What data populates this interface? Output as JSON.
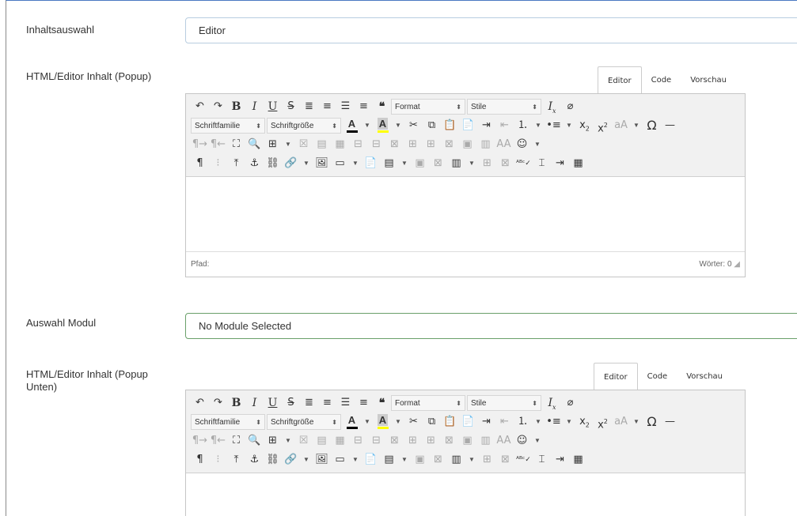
{
  "fields": {
    "inhaltsauswahl": {
      "label": "Inhaltsauswahl",
      "value": "Editor"
    },
    "editor1": {
      "label": "HTML/Editor Inhalt (Popup)"
    },
    "auswahl_modul": {
      "label": "Auswahl Modul",
      "value": "No Module Selected"
    },
    "editor2": {
      "label_line1": "HTML/Editor Inhalt (Popup",
      "label_line2": "Unten)"
    }
  },
  "tabs": {
    "editor": "Editor",
    "code": "Code",
    "vorschau": "Vorschau"
  },
  "toolbar": {
    "format_label": "Format",
    "stile_label": "Stile",
    "schriftfamilie_label": "Schriftfamilie",
    "schriftgroesse_label": "Schriftgröße",
    "font_color_glyph": "A",
    "bg_color_glyph": "A",
    "font_color": "#000000",
    "bg_color": "#ffff00"
  },
  "statusbar": {
    "path_label": "Pfad:",
    "word_count": "Wörter: 0"
  },
  "colors": {
    "frame_top": "#4a78c2",
    "field_green": "#6aa06a"
  }
}
